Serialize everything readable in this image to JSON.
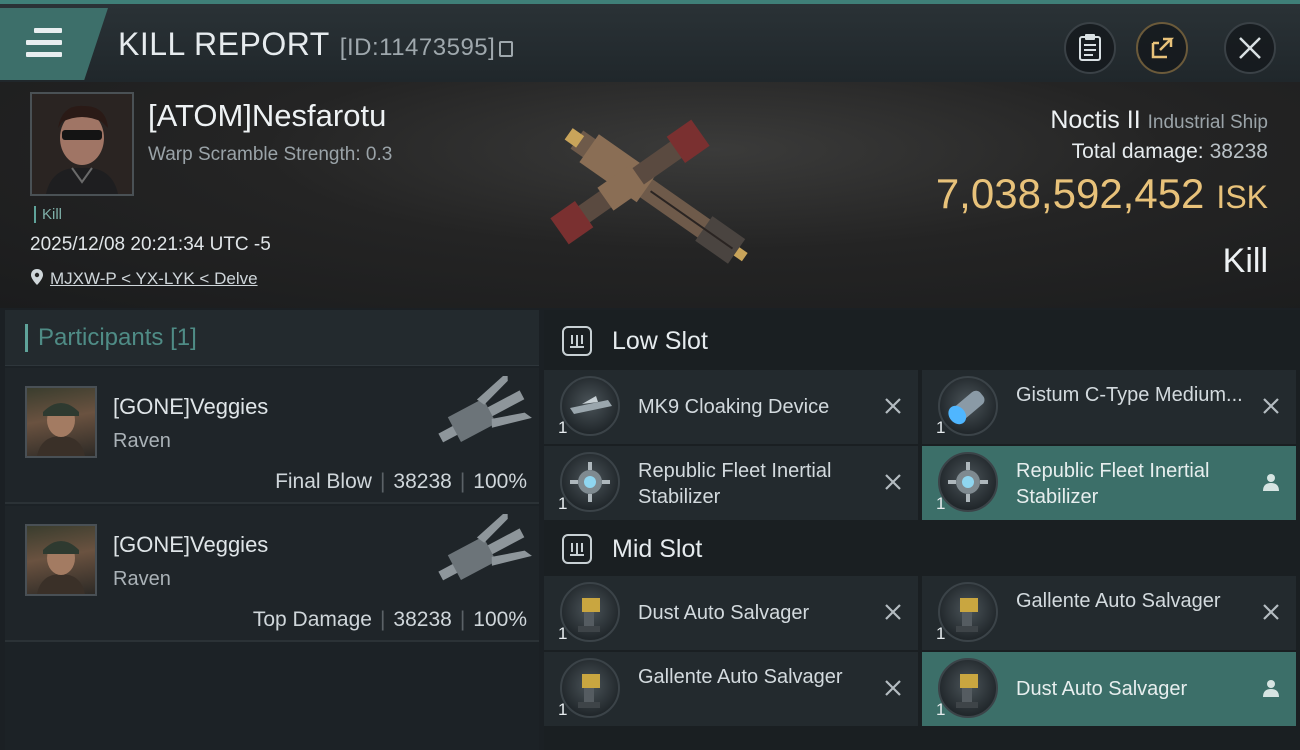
{
  "header": {
    "title": "KILL REPORT",
    "report_id": "[ID:11473595]"
  },
  "victim": {
    "name": "[ATOM]Nesfarotu",
    "warp_scramble": "Warp Scramble Strength: 0.3",
    "tag": "Kill",
    "datetime": "2025/12/08 20:21:34 UTC -5",
    "location": "MJXW-P < YX-LYK < Delve",
    "ship_name": "Noctis II",
    "ship_class": "Industrial Ship",
    "total_damage_label": "Total damage:",
    "total_damage": "38238",
    "isk_value": "7,038,592,452",
    "isk_unit": "ISK",
    "result": "Kill"
  },
  "participants": {
    "title": "Participants",
    "count": "[1]",
    "rows": [
      {
        "name": "[GONE]Veggies",
        "ship": "Raven",
        "role": "Final Blow",
        "damage": "38238",
        "percent": "100%"
      },
      {
        "name": "[GONE]Veggies",
        "ship": "Raven",
        "role": "Top Damage",
        "damage": "38238",
        "percent": "100%"
      }
    ]
  },
  "slots": {
    "low": {
      "title": "Low Slot",
      "modules": [
        {
          "name": "MK9 Cloaking Device",
          "qty": "1",
          "status": "destroyed"
        },
        {
          "name": "Gistum C-Type Medium...",
          "qty": "1",
          "status": "destroyed"
        },
        {
          "name": "Republic Fleet Inertial Stabilizer",
          "qty": "1",
          "status": "destroyed"
        },
        {
          "name": "Republic Fleet Inertial Stabilizer",
          "qty": "1",
          "status": "dropped"
        }
      ]
    },
    "mid": {
      "title": "Mid Slot",
      "modules": [
        {
          "name": "Dust Auto Salvager",
          "qty": "1",
          "status": "destroyed"
        },
        {
          "name": "Gallente Auto Salvager",
          "qty": "1",
          "status": "destroyed"
        },
        {
          "name": "Gallente Auto Salvager",
          "qty": "1",
          "status": "destroyed"
        },
        {
          "name": "Dust Auto Salvager",
          "qty": "1",
          "status": "dropped"
        }
      ]
    }
  },
  "colors": {
    "accent": "#3c6f69",
    "isk": "#e8c27a"
  }
}
